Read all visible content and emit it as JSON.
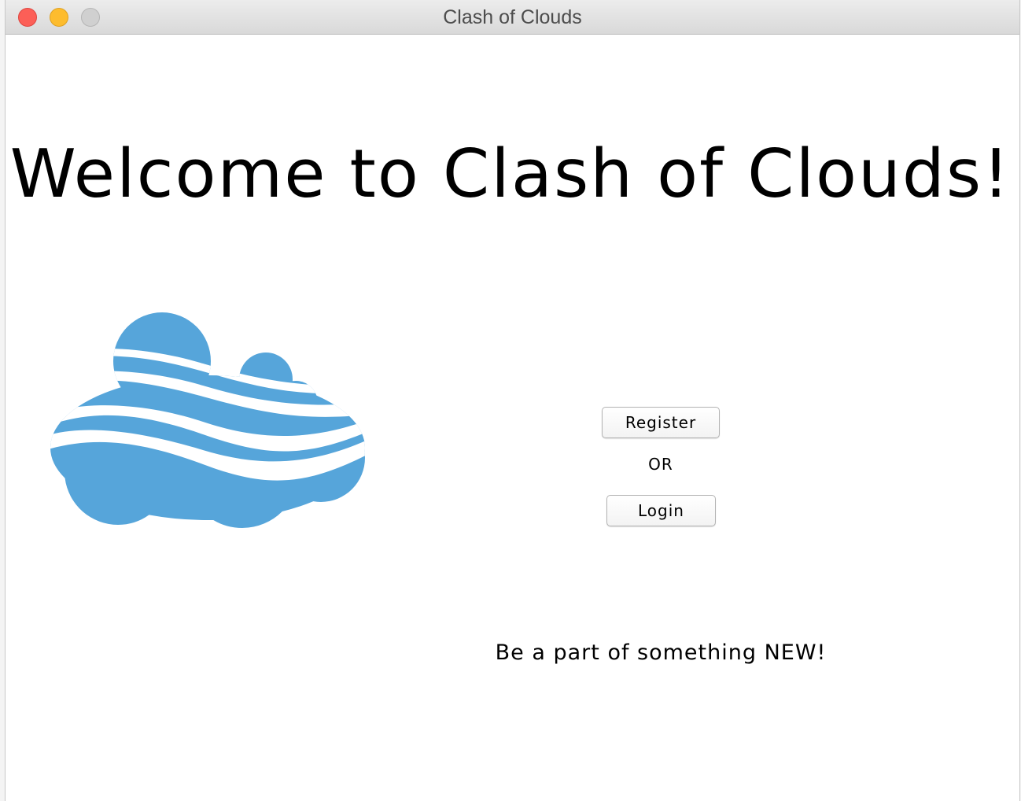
{
  "window": {
    "title": "Clash of Clouds"
  },
  "main": {
    "welcome": "Welcome to Clash of Clouds!",
    "register_label": "Register",
    "or_label": "OR",
    "login_label": "Login",
    "tagline": "Be a part of something NEW!"
  },
  "logo": {
    "icon": "cloud-logo-icon",
    "color": "#56a5da"
  },
  "colors": {
    "close": "#fc5f57",
    "minimize": "#fdbc2e",
    "zoom": "#d0d0d0"
  }
}
